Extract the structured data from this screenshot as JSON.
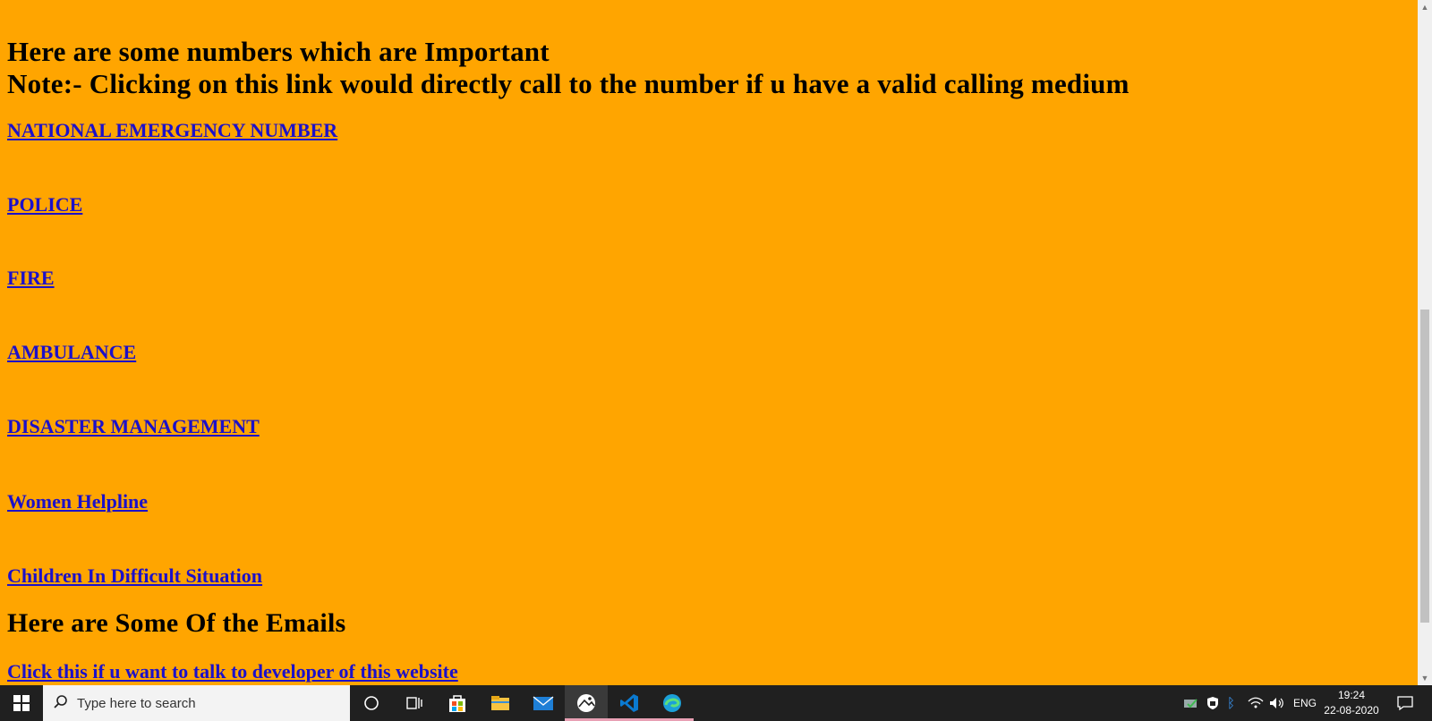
{
  "page": {
    "heading_line1": "Here are some numbers which are Important",
    "heading_line2": "Note:- Clicking on this link would directly call to the number if u have a valid calling medium",
    "links": [
      "NATIONAL EMERGENCY NUMBER",
      "POLICE",
      "FIRE",
      "AMBULANCE",
      "DISASTER MANAGEMENT",
      "Women Helpline",
      "Children In Difficult Situation"
    ],
    "emails_heading": "Here are Some Of the Emails",
    "developer_link": "Click this if u want to talk to developer of this website"
  },
  "colors": {
    "background": "#ffa500",
    "link": "#1c10c9",
    "taskbar": "#202020"
  },
  "taskbar": {
    "search_placeholder": "Type here to search",
    "language": "ENG",
    "time": "19:24",
    "date": "22-08-2020",
    "icons": [
      "windows-start-icon",
      "search-icon",
      "cortana-icon",
      "task-view-icon",
      "store-icon",
      "file-explorer-icon",
      "mail-icon",
      "photos-icon",
      "vscode-icon",
      "edge-icon"
    ],
    "tray_icons": [
      "defender-icon",
      "security-icon",
      "bluetooth-icon",
      "wifi-icon",
      "volume-icon",
      "notification-icon"
    ]
  }
}
